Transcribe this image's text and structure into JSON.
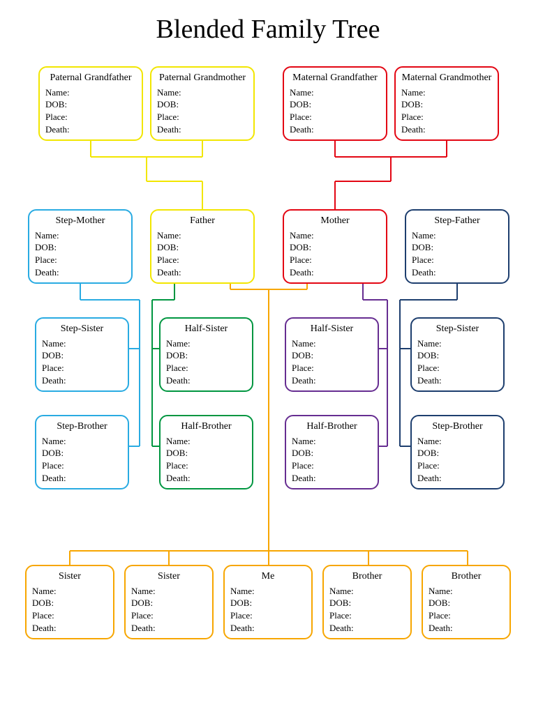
{
  "title": "Blended Family Tree",
  "fields": {
    "name": "Name:",
    "dob": "DOB:",
    "place": "Place:",
    "death": "Death:"
  },
  "colors": {
    "yellow": "#f2e600",
    "red": "#e30613",
    "cyan": "#29abe2",
    "green": "#009640",
    "purple": "#662d91",
    "navy": "#1d3e6e",
    "orange": "#f7a600"
  },
  "boxes": {
    "paternal_grandfather": "Paternal Grandfather",
    "paternal_grandmother": "Paternal Grandmother",
    "maternal_grandfather": "Maternal Grandfather",
    "maternal_grandmother": "Maternal Grandmother",
    "step_mother": "Step-Mother",
    "father": "Father",
    "mother": "Mother",
    "step_father": "Step-Father",
    "step_sister_left": "Step-Sister",
    "half_sister_left": "Half-Sister",
    "half_sister_right": "Half-Sister",
    "step_sister_right": "Step-Sister",
    "step_brother_left": "Step-Brother",
    "half_brother_left": "Half-Brother",
    "half_brother_right": "Half-Brother",
    "step_brother_right": "Step-Brother",
    "sister1": "Sister",
    "sister2": "Sister",
    "me": "Me",
    "brother1": "Brother",
    "brother2": "Brother"
  }
}
